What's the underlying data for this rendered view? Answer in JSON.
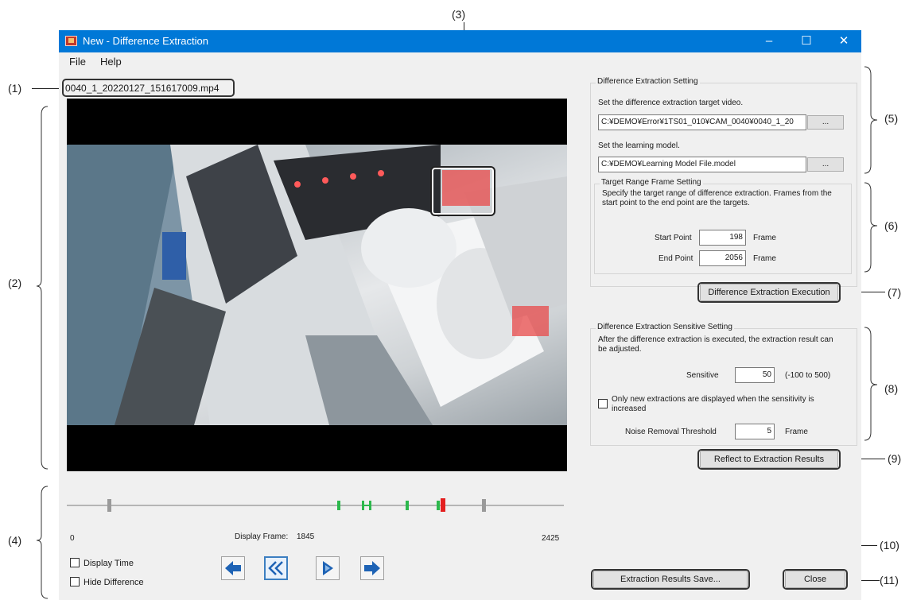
{
  "callouts": [
    "(1)",
    "(2)",
    "(3)",
    "(4)",
    "(5)",
    "(6)",
    "(7)",
    "(8)",
    "(9)",
    "(10)",
    "(11)"
  ],
  "window": {
    "title": "New - Difference Extraction",
    "controls": {
      "minimize": "–",
      "maximize": "☐",
      "close": "✕"
    }
  },
  "menu": [
    "File",
    "Help"
  ],
  "video": {
    "file_name": "0040_1_20220127_151617009.mp4"
  },
  "timeline": {
    "start_frame": "0",
    "end_frame": "2425",
    "display_frame_label": "Display Frame:",
    "display_frame_value": "1845"
  },
  "options": {
    "display_time": "Display Time",
    "hide_difference": "Hide Difference"
  },
  "nav_icons": [
    "arrow-left-icon",
    "rewind-icon",
    "play-icon",
    "arrow-right-icon"
  ],
  "extraction_setting": {
    "title": "Difference Extraction Setting",
    "video_label": "Set the difference extraction target video.",
    "video_path": "C:¥DEMO¥Error¥1TS01_010¥CAM_0040¥0040_1_20",
    "model_label": "Set the learning model.",
    "model_path": "C:¥DEMO¥Learning Model File.model",
    "browse": "..."
  },
  "range_setting": {
    "title": "Target Range Frame Setting",
    "description": "Specify the target range of difference extraction. Frames from the start point to the end point are the targets.",
    "start_label": "Start Point",
    "start_value": "198",
    "end_label": "End Point",
    "end_value": "2056",
    "unit": "Frame"
  },
  "execute_button": "Difference Extraction Execution",
  "sensitive_setting": {
    "title": "Difference Extraction Sensitive Setting",
    "description": "After the difference extraction is executed, the extraction result can be adjusted.",
    "sensitive_label": "Sensitive",
    "sensitive_value": "50",
    "sensitive_range": "(-100 to 500)",
    "only_new_label": "Only new extractions are displayed when the sensitivity is increased",
    "noise_label": "Noise Removal Threshold",
    "noise_value": "5",
    "unit": "Frame"
  },
  "reflect_button": "Reflect to Extraction Results",
  "save_button": "Extraction Results Save...",
  "close_button": "Close",
  "colors": {
    "titlebar": "#0078d7",
    "marker_green": "#2db84d",
    "marker_red": "#e41f1f",
    "highlight": "#e84a4a"
  }
}
